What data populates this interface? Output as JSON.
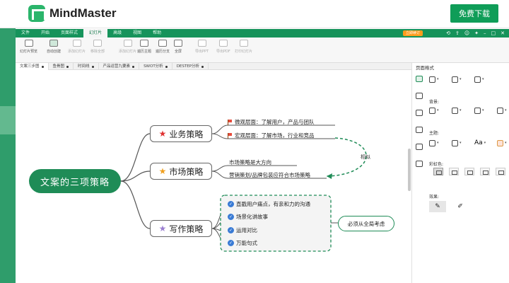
{
  "header": {
    "brand": "MindMaster",
    "download_label": "免费下载"
  },
  "menu": {
    "items": [
      "文件",
      "开始",
      "页面样式",
      "幻灯片",
      "高级",
      "视图",
      "帮助"
    ],
    "active_index": 3,
    "vip_label": "立即续订"
  },
  "ribbon": {
    "buttons": [
      {
        "label": "幻灯片预览",
        "state": "normal"
      },
      {
        "label": "自动创建",
        "state": "active"
      },
      {
        "label": "添加幻灯片",
        "state": "dim"
      },
      {
        "label": "移除全部",
        "state": "dim"
      },
      {
        "label": "添加幻灯片",
        "state": "dim"
      },
      {
        "label": "遍历主题",
        "state": "normal"
      },
      {
        "label": "遍历分支",
        "state": "normal"
      },
      {
        "label": "全屏",
        "state": "normal"
      },
      {
        "label": "导出PPT",
        "state": "dim"
      },
      {
        "label": "导出PDF",
        "state": "dim"
      },
      {
        "label": "打印幻灯片",
        "state": "dim"
      }
    ]
  },
  "tabs": [
    "文案三步图",
    "鱼骨图",
    "时间线",
    "产品运营九要素",
    "SWOT分析",
    "DESTEP分析"
  ],
  "mindmap": {
    "root": "文案的三项策略",
    "branches": [
      {
        "label": "业务策略",
        "star_color": "#e03131",
        "leaves": [
          "微观层面：了解用户，产品与团队",
          "宏观层面：了解市场，行业和竞品"
        ]
      },
      {
        "label": "市场策略",
        "star_color": "#f0a020",
        "leaves": [
          "市场策略是大方向",
          "营销策划/品牌包装应符合市场策略"
        ]
      },
      {
        "label": "写作策略",
        "star_color": "#9b7fd1",
        "leaves": [
          "直戳用户痛点，有亲和力的沟通",
          "场景化讲故事",
          "运用对比",
          "万能句式"
        ]
      }
    ],
    "relation_label": "相似",
    "callout": "必须从全局考虑"
  },
  "right_panel": {
    "title": "页面格式",
    "background_label": "背景:",
    "theme_label": "主题:",
    "color_label": "彩虹色:",
    "effect_label": "效果:",
    "font_label": "Aa"
  },
  "colors": {
    "brand_green": "#1f8c57",
    "menu_green": "#16935b",
    "accent_orange": "#ff9c1b"
  }
}
